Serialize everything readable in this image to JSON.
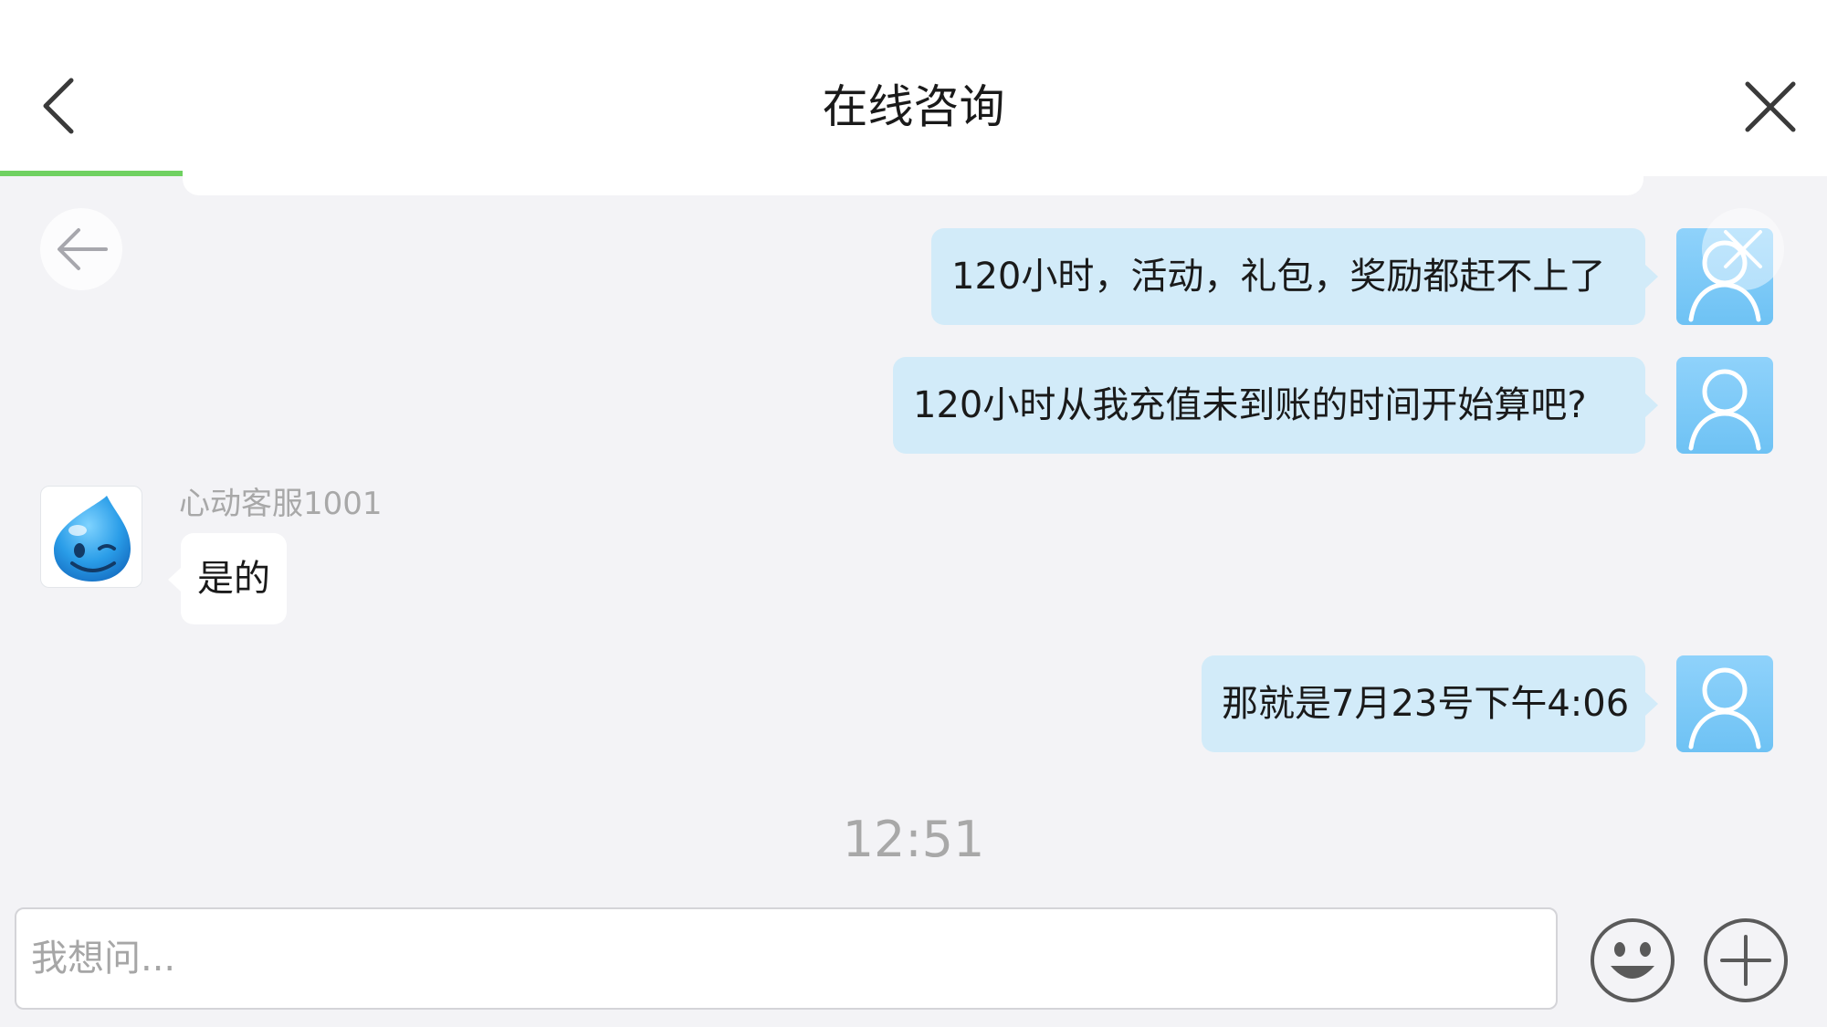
{
  "header": {
    "title": "在线咨询",
    "progress": 0.1
  },
  "messages": [
    {
      "from": "user",
      "text": "120小时，活动，礼包，奖励都赶不上了"
    },
    {
      "from": "user",
      "text": "120小时从我充值未到账的时间开始算吧?"
    },
    {
      "from": "agent",
      "sender": "心动客服1001",
      "text": "是的"
    },
    {
      "from": "user",
      "text": "那就是7月23号下午4:06"
    }
  ],
  "timestamp": "12:51",
  "input": {
    "placeholder": "我想问...",
    "value": ""
  },
  "colors": {
    "accent_progress": "#6fd161",
    "user_bubble": "#d2ebf9",
    "agent_bubble": "#ffffff",
    "background": "#f3f3f6"
  },
  "icons": {
    "header_back": "chevron-left-icon",
    "header_close": "close-icon",
    "float_back": "arrow-left-icon",
    "float_close": "close-icon",
    "emoji": "smiley-icon",
    "plus": "plus-circle-icon",
    "user_avatar": "person-outline-icon",
    "agent_avatar": "water-drop-mascot-icon"
  }
}
